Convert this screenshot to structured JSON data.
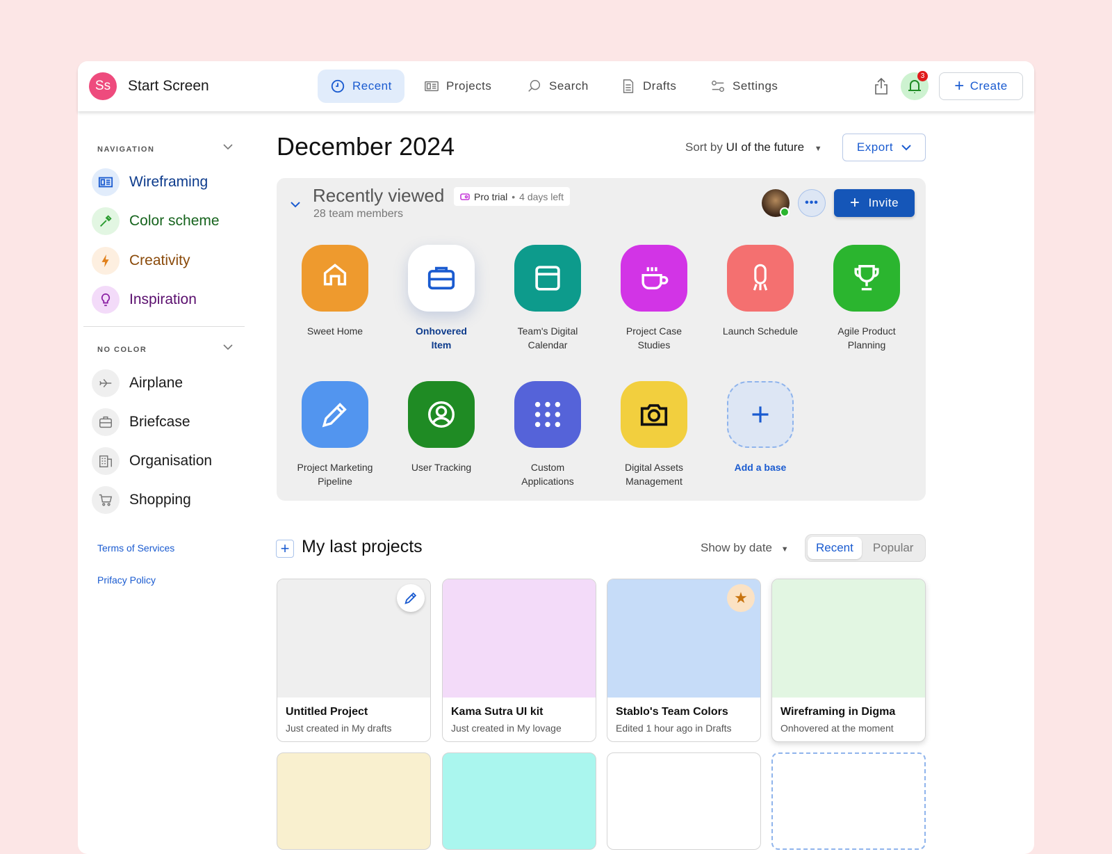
{
  "header": {
    "avatar_initials": "Ss",
    "title": "Start Screen",
    "nav": [
      {
        "label": "Recent",
        "icon": "clock-icon"
      },
      {
        "label": "Projects",
        "icon": "projects-icon"
      },
      {
        "label": "Search",
        "icon": "search-icon"
      },
      {
        "label": "Drafts",
        "icon": "document-icon"
      },
      {
        "label": "Settings",
        "icon": "settings-icon"
      }
    ],
    "notification_count": "3",
    "create_label": "Create"
  },
  "sidebar": {
    "navigation_heading": "NAVIGATION",
    "navigation_items": [
      {
        "label": "Wireframing",
        "color": "#0d3b8c"
      },
      {
        "label": "Color scheme",
        "color": "#16631d"
      },
      {
        "label": "Creativity",
        "color": "#8a4a0a"
      },
      {
        "label": "Inspiration",
        "color": "#5a0f6e"
      }
    ],
    "nocolor_heading": "NO COLOR",
    "nocolor_items": [
      {
        "label": "Airplane"
      },
      {
        "label": "Briefcase"
      },
      {
        "label": "Organisation"
      },
      {
        "label": "Shopping"
      }
    ],
    "links": [
      "Terms of Services",
      "Prifacy Policy"
    ]
  },
  "main": {
    "title": "December 2024",
    "sort_prefix": "Sort by",
    "sort_value": "UI of the future",
    "export_label": "Export",
    "recent": {
      "title": "Recently viewed",
      "subtitle": "28 team members",
      "trial_label": "Pro trial",
      "trial_remaining": "4 days left",
      "invite_label": "Invite",
      "tiles": [
        {
          "label": "Sweet Home",
          "color": "#ee9a2e",
          "icon": "home-icon"
        },
        {
          "label": "Onhovered Item",
          "color": "#ffffff",
          "icon": "briefcase-icon"
        },
        {
          "label": "Team's Digital Calendar",
          "color": "#0d9b8c",
          "icon": "calendar-icon"
        },
        {
          "label": "Project Case Studies",
          "color": "#d234e6",
          "icon": "coffee-icon"
        },
        {
          "label": "Launch Schedule",
          "color": "#f47070",
          "icon": "rocket-icon"
        },
        {
          "label": "Agile Product Planning",
          "color": "#2bb52f",
          "icon": "trophy-icon"
        },
        {
          "label": "Project Marketing Pipeline",
          "color": "#5295ef",
          "icon": "pencil-icon"
        },
        {
          "label": "User Tracking",
          "color": "#1f8b24",
          "icon": "user-icon"
        },
        {
          "label": "Custom Applications",
          "color": "#5563d9",
          "icon": "grid-icon"
        },
        {
          "label": "Digital Assets Management",
          "color": "#f2cf3e",
          "icon": "camera-icon"
        },
        {
          "label": "Add a base",
          "color": "#dde6f4",
          "icon": "plus-icon"
        }
      ]
    },
    "projects": {
      "title": "My last projects",
      "show_by": "Show by date",
      "segments": [
        "Recent",
        "Popular"
      ],
      "cards": [
        {
          "title": "Untitled Project",
          "subtitle": "Just created in My drafts",
          "color": "#efefef"
        },
        {
          "title": "Kama Sutra UI kit",
          "subtitle": "Just created in My lovage",
          "color": "#f3dbf9"
        },
        {
          "title": "Stablo's Team Colors",
          "subtitle": "Edited 1 hour ago in Drafts",
          "color": "#c6dcf8"
        },
        {
          "title": "Wireframing in Digma",
          "subtitle": "Onhovered at the moment",
          "color": "#e2f6e2"
        }
      ],
      "row2_colors": [
        "#f9f0cf",
        "#aaf6ee",
        "#ffffff",
        "#ffffff"
      ]
    }
  }
}
